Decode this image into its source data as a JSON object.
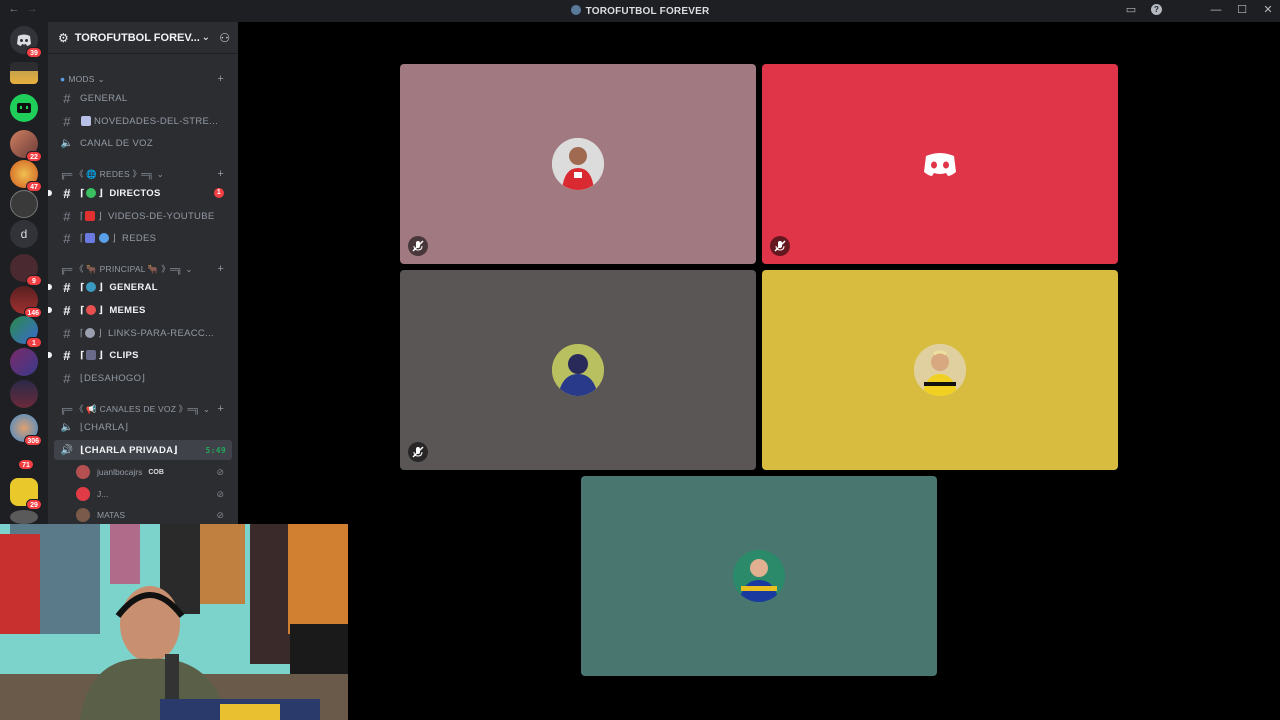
{
  "window": {
    "title": "TOROFUTBOL FOREVER",
    "nav_back": "←",
    "nav_forward": "→",
    "controls": {
      "inbox": "▭",
      "help": "?",
      "minimize": "—",
      "maximize": "☐",
      "close": "✕"
    }
  },
  "servers": [
    {
      "icon": "discord-home-icon",
      "badge": "39",
      "color": "#313338"
    },
    {
      "icon": "server-yellow-icon",
      "badge": "",
      "color": "#c8a24a"
    },
    {
      "icon": "server-green-bot-icon",
      "badge": "",
      "color": "#1fcf5a"
    },
    {
      "icon": "server-anime-icon",
      "badge": "22",
      "color": "#b46a4a"
    },
    {
      "icon": "server-orange-icon",
      "badge": "47",
      "color": "#e88c2c"
    },
    {
      "icon": "server-globe-icon",
      "badge": "",
      "color": "#3a3a3a"
    },
    {
      "icon": "server-d-icon",
      "letter": "d",
      "badge": "",
      "color": "#313338"
    },
    {
      "icon": "server-dark-icon",
      "badge": "9",
      "color": "#4a2a2a"
    },
    {
      "icon": "server-red-icon",
      "badge": "146",
      "color": "#7a2a2a"
    },
    {
      "icon": "server-team-icon",
      "badge": "1",
      "color": "#3a6aa8"
    },
    {
      "icon": "server-purple-icon",
      "badge": "",
      "color": "#6a3a6a"
    },
    {
      "icon": "server-night-icon",
      "badge": "",
      "color": "#2a2a4a"
    },
    {
      "icon": "server-blue-icon",
      "badge": "306",
      "color": "#3a8ad0"
    },
    {
      "icon": "server-red2-icon",
      "badge": "71",
      "color": "#b02a2a"
    },
    {
      "icon": "server-yellow2-icon",
      "badge": "29",
      "color": "#e8c82a"
    },
    {
      "icon": "server-misc-icon",
      "badge": "",
      "color": "#5a5a5a"
    }
  ],
  "sidebar": {
    "server_name": "TOROFUTBOL FOREV...",
    "categories": {
      "mods": "MODS",
      "redes": "╔═ 《 🌐 REDES 》═╗",
      "principal": "╔═ 《 🐂 PRINCIPAL 🐂 》═╗",
      "voz": "╔═ 《 📢 CANALES DE VOZ 》═╗"
    },
    "channels": {
      "general_mods": "GENERAL",
      "novedades": "NOVEDADES-DEL-STRE...",
      "canal_voz": "CANAL DE VOZ",
      "directos": "DIRECTOS",
      "directos_badge": "1",
      "videos": "VIDEOS-DE-YOUTUBE",
      "redes": "REDES",
      "general": "GENERAL",
      "memes": "MEMES",
      "links": "LINKS-PARA-REACC...",
      "clips": "CLIPS",
      "desahogo": "⌊DESAHOGO⌋",
      "charla": "⌊CHARLA⌋",
      "charla_privada": "⌊CHARLA PRIVADA⌋",
      "charla_privada_time": "5:49"
    },
    "voice_users": [
      {
        "name": "juanlbocajrs",
        "tag": "COB",
        "avatar_color": "#b45050"
      },
      {
        "name": "J...",
        "tag": "",
        "avatar_color": "#e23b48"
      },
      {
        "name": "MATAS",
        "tag": "",
        "avatar_color": "#7a5a4a"
      }
    ]
  },
  "stage": {
    "tiles": [
      {
        "id": "user-1",
        "bg": "#a07a80",
        "muted": true,
        "avatar": "avatar-red-jersey-player"
      },
      {
        "id": "user-2",
        "bg": "#e03448",
        "muted": true,
        "avatar": "discord-default-avatar"
      },
      {
        "id": "user-3",
        "bg": "#5a5656",
        "muted": true,
        "avatar": "avatar-blue-hoodie"
      },
      {
        "id": "user-4",
        "bg": "#d8bc40",
        "muted": false,
        "avatar": "avatar-yellow-jersey-player"
      },
      {
        "id": "user-5",
        "bg": "#4a7670",
        "muted": false,
        "avatar": "avatar-blue-jersey-fan"
      }
    ]
  }
}
